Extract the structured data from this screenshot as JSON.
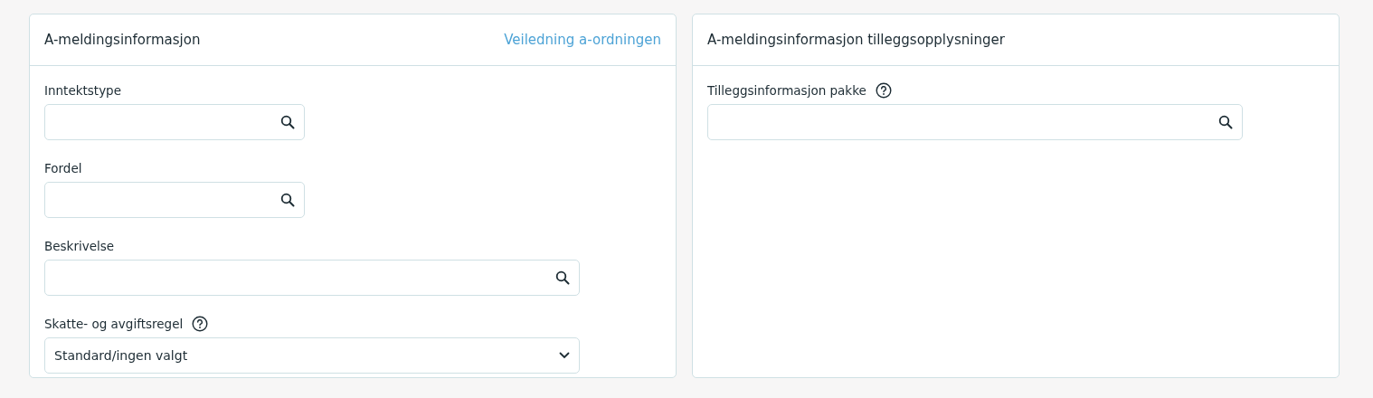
{
  "panels": [
    {
      "title": "A-meldingsinformasjon",
      "link": "Veiledning a-ordningen",
      "fields": [
        {
          "label": "Inntektstype",
          "kind": "search",
          "wide": false,
          "help": false
        },
        {
          "label": "Fordel",
          "kind": "search",
          "wide": false,
          "help": false
        },
        {
          "label": "Beskrivelse",
          "kind": "search",
          "wide": true,
          "help": false
        },
        {
          "label": "Skatte- og avgiftsregel",
          "kind": "select",
          "wide": true,
          "help": true,
          "value": "Standard/ingen valgt"
        }
      ]
    },
    {
      "title": "A-meldingsinformasjon tilleggsopplysninger",
      "fields": [
        {
          "label": "Tilleggsinformasjon pakke",
          "kind": "search",
          "wide": true,
          "help": true
        }
      ]
    }
  ]
}
